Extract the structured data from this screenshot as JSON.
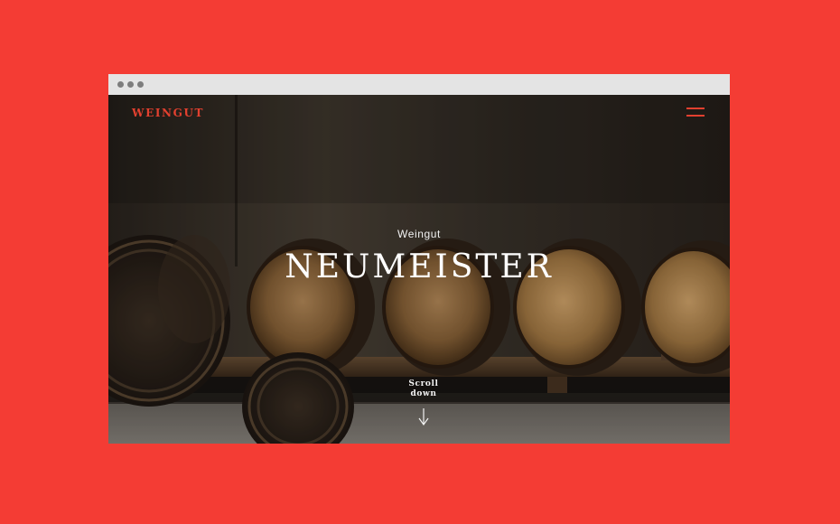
{
  "page": {
    "background_color": "#f43c34"
  },
  "browser": {
    "chrome_color": "#e4e4e4",
    "window_controls": [
      "dot-icon",
      "dot-icon",
      "dot-icon"
    ]
  },
  "site": {
    "logo": "WEINGUT",
    "accent_color": "#e2402f",
    "menu_icon": "hamburger-icon"
  },
  "hero": {
    "kicker": "Weingut",
    "title": "NEUMEISTER",
    "scroll_line1": "Scroll",
    "scroll_line2": "down",
    "scroll_icon": "arrow-down-icon"
  }
}
